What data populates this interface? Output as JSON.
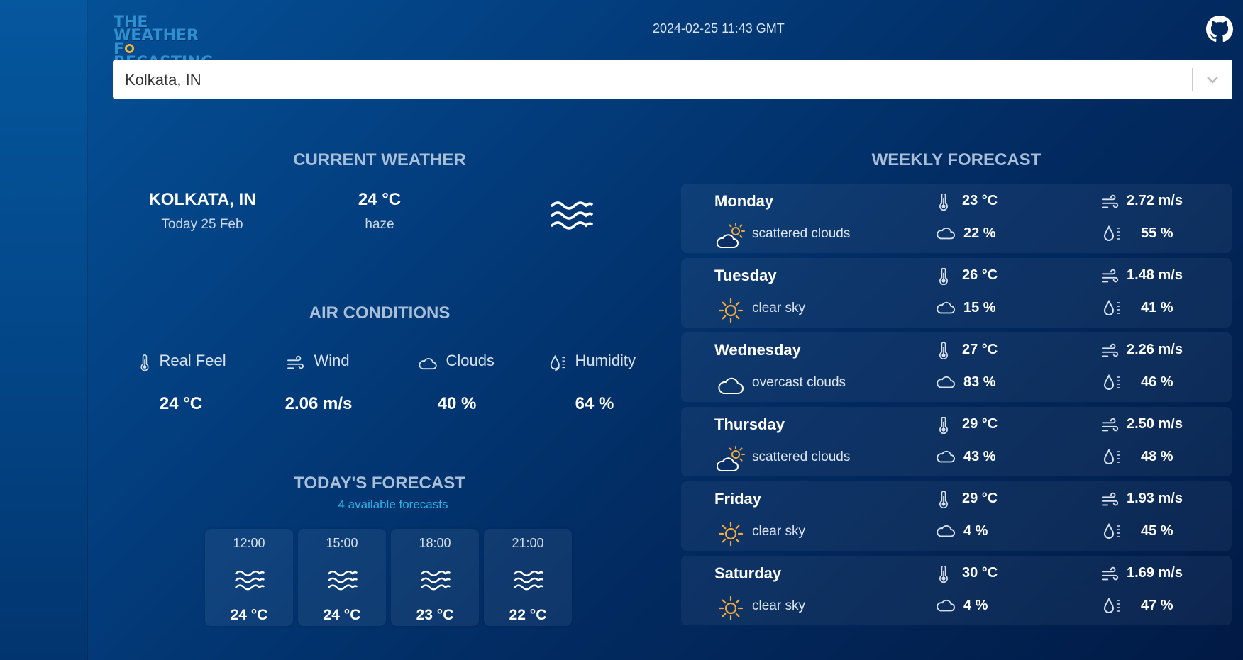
{
  "header": {
    "logo_line1": "THE WEATHER",
    "logo_line2_a": "F",
    "logo_line2_b": "RECASTING",
    "datetime": "2024-02-25 11:43 GMT",
    "github_icon": "github-icon"
  },
  "search": {
    "value": "Kolkata, IN"
  },
  "current_weather": {
    "title": "CURRENT WEATHER",
    "city": "KOLKATA, IN",
    "date": "Today 25 Feb",
    "temp": "24 °C",
    "description": "haze",
    "icon": "haze-icon"
  },
  "air_conditions": {
    "title": "AIR CONDITIONS",
    "items": [
      {
        "label": "Real Feel",
        "value": "24 °C",
        "icon": "thermometer-icon"
      },
      {
        "label": "Wind",
        "value": "2.06 m/s",
        "icon": "wind-icon"
      },
      {
        "label": "Clouds",
        "value": "40 %",
        "icon": "cloud-icon"
      },
      {
        "label": "Humidity",
        "value": "64 %",
        "icon": "humidity-icon"
      }
    ]
  },
  "todays_forecast": {
    "title": "TODAY'S FORECAST",
    "subtitle": "4 available forecasts",
    "items": [
      {
        "time": "12:00",
        "temp": "24 °C",
        "icon": "haze-icon"
      },
      {
        "time": "15:00",
        "temp": "24 °C",
        "icon": "haze-icon"
      },
      {
        "time": "18:00",
        "temp": "23 °C",
        "icon": "haze-icon"
      },
      {
        "time": "21:00",
        "temp": "22 °C",
        "icon": "haze-icon"
      }
    ]
  },
  "weekly_forecast": {
    "title": "WEEKLY FORECAST",
    "days": [
      {
        "day": "Monday",
        "desc": "scattered clouds",
        "icon": "partly-cloudy-icon",
        "temp": "23 °C",
        "clouds": "22 %",
        "wind": "2.72 m/s",
        "humidity": "55 %"
      },
      {
        "day": "Tuesday",
        "desc": "clear sky",
        "icon": "sun-icon",
        "temp": "26 °C",
        "clouds": "15 %",
        "wind": "1.48 m/s",
        "humidity": "41 %"
      },
      {
        "day": "Wednesday",
        "desc": "overcast clouds",
        "icon": "cloud-icon",
        "temp": "27 °C",
        "clouds": "83 %",
        "wind": "2.26 m/s",
        "humidity": "46 %"
      },
      {
        "day": "Thursday",
        "desc": "scattered clouds",
        "icon": "partly-cloudy-icon",
        "temp": "29 °C",
        "clouds": "43 %",
        "wind": "2.50 m/s",
        "humidity": "48 %"
      },
      {
        "day": "Friday",
        "desc": "clear sky",
        "icon": "sun-icon",
        "temp": "29 °C",
        "clouds": "4 %",
        "wind": "1.93 m/s",
        "humidity": "45 %"
      },
      {
        "day": "Saturday",
        "desc": "clear sky",
        "icon": "sun-icon",
        "temp": "30 °C",
        "clouds": "4 %",
        "wind": "1.69 m/s",
        "humidity": "47 %"
      }
    ]
  },
  "colors": {
    "background": "#033f80",
    "accent_title": "#a9bfd8",
    "subtitle": "#2fb0e6",
    "sun": "#f2a93b"
  }
}
